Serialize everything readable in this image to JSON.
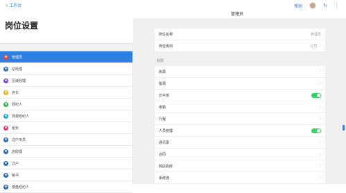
{
  "topbar": {
    "back_label": "工作台",
    "help_label": "帮助"
  },
  "page": {
    "title": "岗位设置",
    "header_title": "管理员"
  },
  "sidebar": {
    "items": [
      {
        "label": "管理员",
        "icon": "person-icon",
        "color": "#e54d2e",
        "active": true
      },
      {
        "label": "总经理",
        "icon": "person-icon",
        "color": "#2f6fb6",
        "active": false
      },
      {
        "label": "区域经理",
        "icon": "person-icon",
        "color": "#7a4ad8",
        "active": false
      },
      {
        "label": "店长",
        "icon": "person-icon",
        "color": "#f0b313",
        "active": false
      },
      {
        "label": "经纪人",
        "icon": "person-icon",
        "color": "#33b34a",
        "active": false
      },
      {
        "label": "简报经纪人",
        "icon": "person-icon",
        "color": "#29a3d9",
        "active": false
      },
      {
        "label": "组长",
        "icon": "person-icon",
        "color": "#e63a73",
        "active": false
      },
      {
        "label": "过户专员",
        "icon": "person-icon",
        "color": "#2a6ab0",
        "active": false
      },
      {
        "label": "店助理",
        "icon": "person-icon",
        "color": "#2a6ab0",
        "active": false
      },
      {
        "label": "过户",
        "icon": "person-icon",
        "color": "#2a6ab0",
        "active": false
      },
      {
        "label": "秘书",
        "icon": "person-icon",
        "color": "#2a6ab0",
        "active": false
      },
      {
        "label": "楼盘经纪人",
        "icon": "person-icon",
        "color": "#2a6ab0",
        "active": false
      }
    ]
  },
  "info": {
    "rows": [
      {
        "label": "岗位名称",
        "value": "管理员"
      },
      {
        "label": "岗位级别",
        "value": "公司"
      }
    ]
  },
  "permissions": {
    "section_label": "权限",
    "rows": [
      {
        "label": "房源",
        "type": "nav"
      },
      {
        "label": "客源",
        "type": "nav"
      },
      {
        "label": "云平房",
        "type": "toggle",
        "on": true
      },
      {
        "label": "考勤",
        "type": "nav"
      },
      {
        "label": "行程",
        "type": "nav"
      },
      {
        "label": "人员管理",
        "type": "toggle",
        "on": true
      },
      {
        "label": "通讯录",
        "type": "nav"
      },
      {
        "label": "合同",
        "type": "nav"
      },
      {
        "label": "跨店看房",
        "type": "nav"
      },
      {
        "label": "系统通",
        "type": "nav"
      }
    ]
  }
}
